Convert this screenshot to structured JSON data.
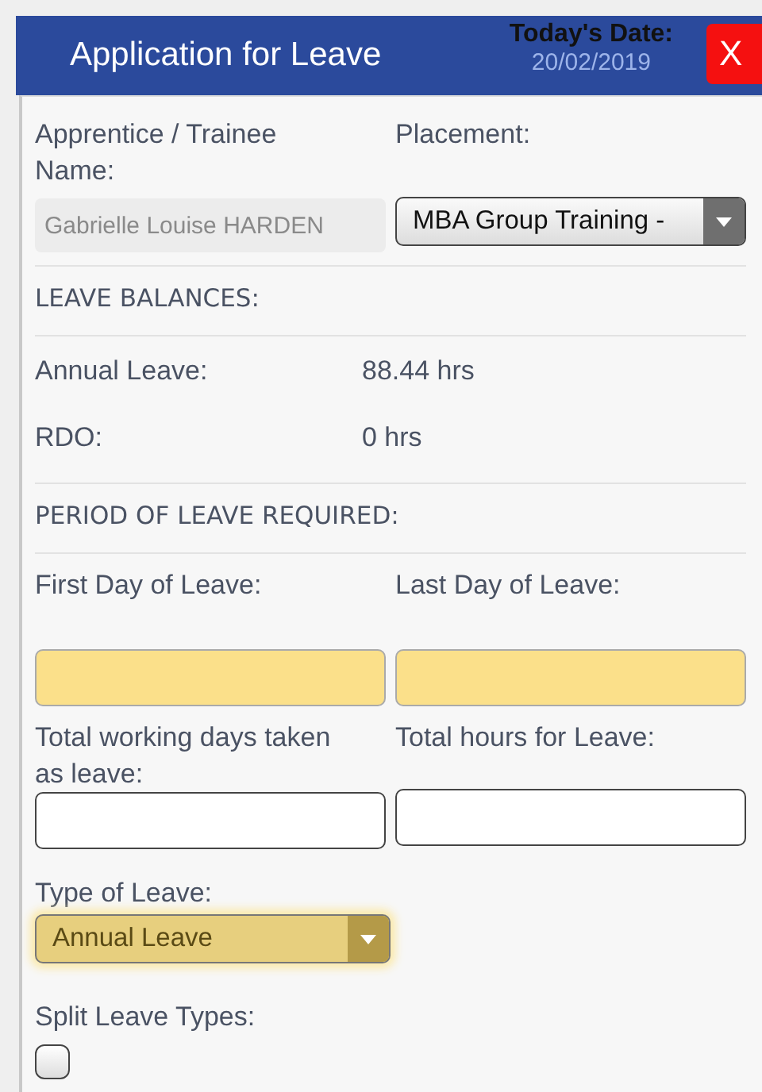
{
  "header": {
    "title": "Application for Leave",
    "date_label": "Today's Date:",
    "date_value": "20/02/2019",
    "close": "X"
  },
  "name_field": {
    "label": "Apprentice / Trainee Name:",
    "value": "Gabrielle Louise HARDEN",
    "disabled": true
  },
  "placement": {
    "label": "Placement:",
    "value": "MBA Group Training -"
  },
  "balances": {
    "heading": "LEAVE BALANCES:",
    "rows": [
      {
        "label": "Annual Leave:",
        "value": "88.44 hrs"
      },
      {
        "label": "RDO:",
        "value": "0 hrs"
      }
    ]
  },
  "period": {
    "heading": "PERIOD OF LEAVE REQUIRED:",
    "fields": [
      {
        "label": "First Day of Leave:",
        "highlighted": true
      },
      {
        "label": "Last Day of Leave:",
        "highlighted": true
      },
      {
        "label": "Total working days taken as leave:",
        "highlighted": false
      },
      {
        "label": "Total hours for Leave:",
        "highlighted": false
      }
    ]
  },
  "leave_type": {
    "label": "Type of Leave:",
    "value": "Annual Leave",
    "highlighted": true
  },
  "split": {
    "label": "Split Leave Types:",
    "checked": false
  }
}
